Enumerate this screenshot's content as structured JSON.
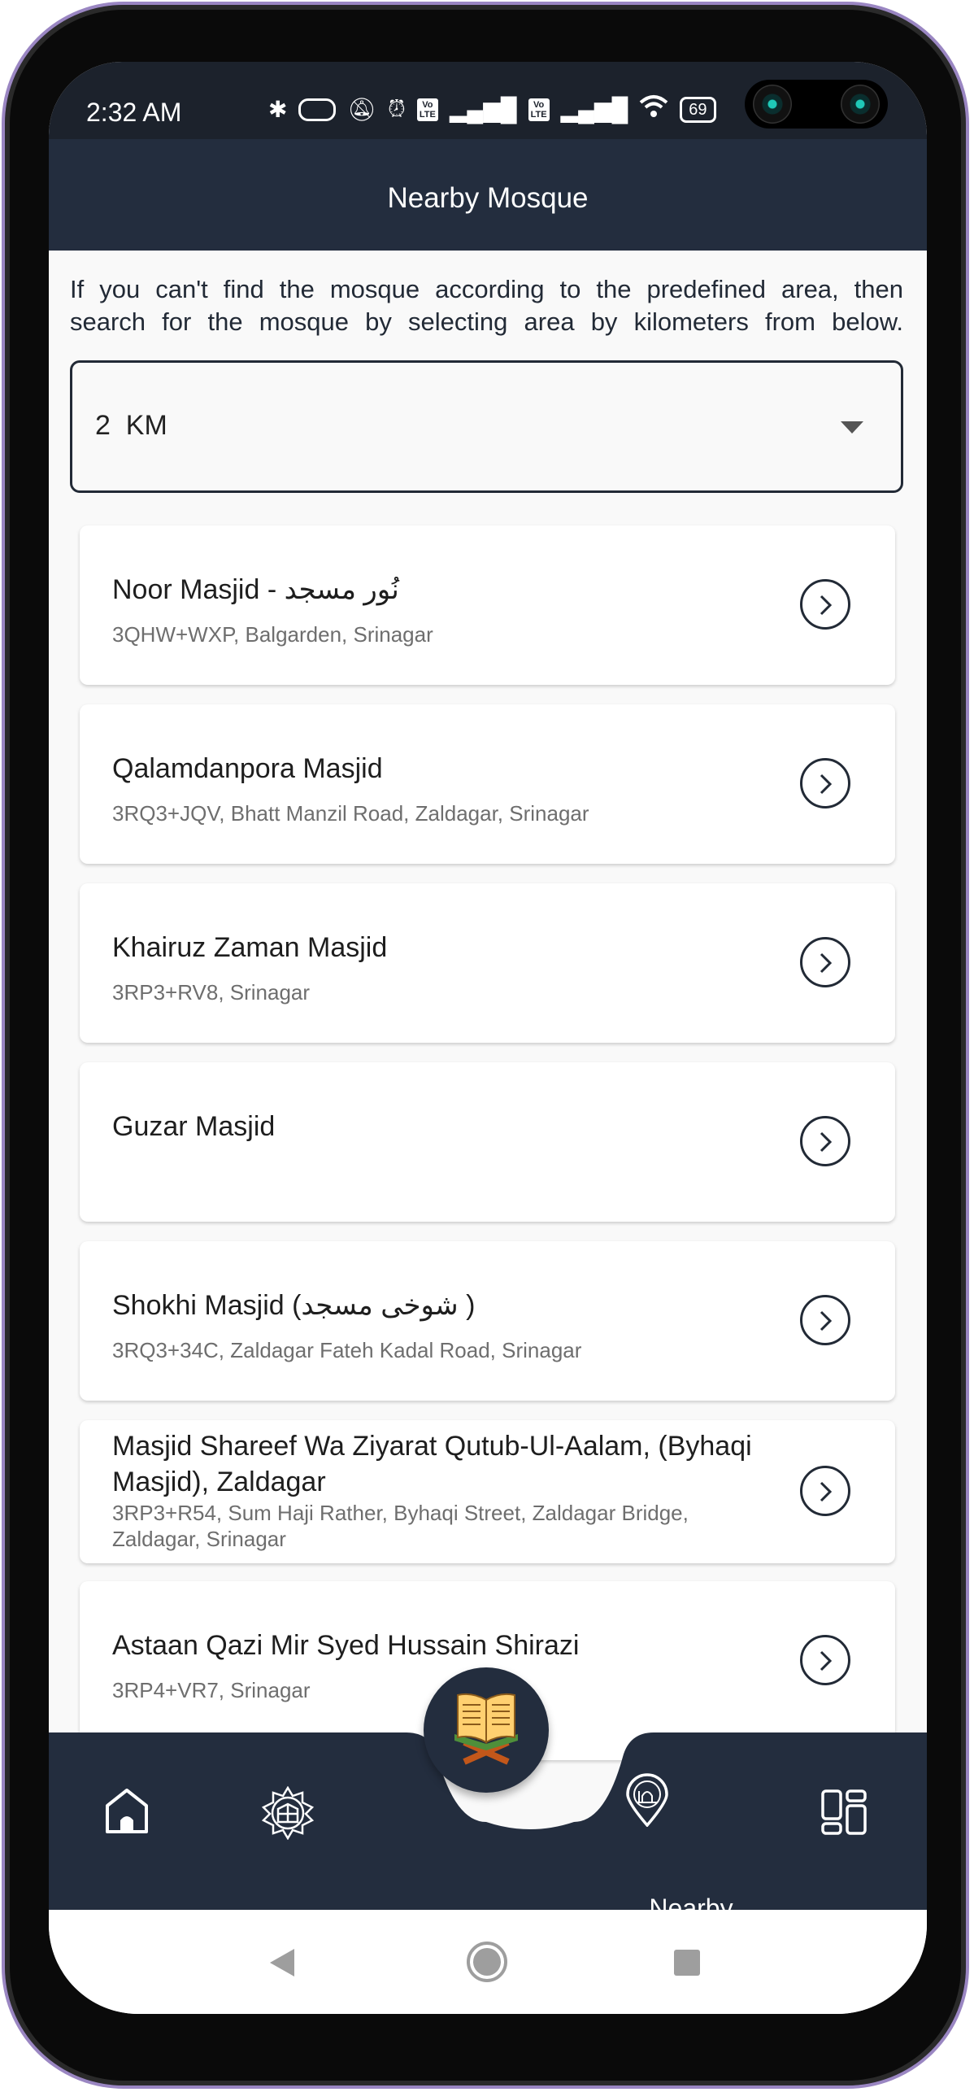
{
  "status_bar": {
    "time": "2:32 AM",
    "battery": "69",
    "volte": "Vo LTE",
    "icons": [
      "bluetooth-icon",
      "toggle-icon",
      "vibrate-off-icon",
      "alarm-icon",
      "volte-icon",
      "signal-icon",
      "volte-icon",
      "signal-icon",
      "wifi-icon",
      "battery-icon"
    ]
  },
  "header": {
    "title": "Nearby Mosque"
  },
  "intro": {
    "line1": "If you can't find the mosque according to the predefined area, then",
    "line2": "search for the mosque by selecting area by kilometers from below."
  },
  "distance_dropdown": {
    "selected": "2  KM"
  },
  "mosques": [
    {
      "name": "Noor Masjid - نُور مسجد",
      "address": "3QHW+WXP, Balgarden, Srinagar"
    },
    {
      "name": "Qalamdanpora Masjid",
      "address": "3RQ3+JQV, Bhatt Manzil Road, Zaldagar, Srinagar"
    },
    {
      "name": "Khairuz Zaman Masjid",
      "address": "3RP3+RV8, Srinagar"
    },
    {
      "name": "Guzar Masjid",
      "address": ""
    },
    {
      "name": "Shokhi Masjid (شوخی مسجد )",
      "address": "3RQ3+34C, Zaldagar Fateh Kadal Road, Srinagar"
    },
    {
      "name": "Masjid Shareef Wa Ziyarat Qutub-Ul-Aalam, (Byhaqi Masjid), Zaldagar",
      "address": "3RP3+R54, Sum Haji Rather, Byhaqi Street, Zaldagar Bridge, Zaldagar, Srinagar"
    },
    {
      "name": "Astaan Qazi Mir Syed Hussain Shirazi",
      "address": "3RP4+VR7, Srinagar"
    }
  ],
  "bottom_nav": {
    "active": "Nearby",
    "nearby_label": "Nearby",
    "items": [
      "home-icon",
      "qibla-compass-icon",
      "quran-icon",
      "nearby-mosque-icon",
      "dashboard-icon"
    ]
  },
  "colors": {
    "primary": "#232d3e",
    "status": "#1c222c",
    "background": "#f9f9f9",
    "address_text": "#6e6e6e"
  }
}
